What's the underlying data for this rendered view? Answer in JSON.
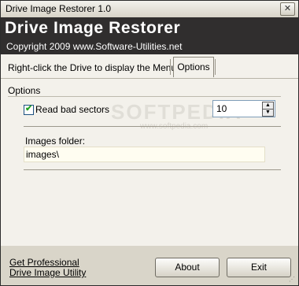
{
  "window": {
    "title": "Drive Image Restorer 1.0",
    "close_glyph": "✕"
  },
  "banner": {
    "title": "Drive Image Restorer",
    "subtitle": "Copyright 2009 www.Software-Utilities.net"
  },
  "tabs": {
    "menu_hint": "Right-click the Drive to display the Menu",
    "options_label": "Options"
  },
  "options": {
    "group_label": "Options",
    "read_bad_sectors_label": "Read bad sectors",
    "read_bad_sectors_checked": true,
    "retry_value": "10",
    "images_folder_label": "Images folder:",
    "images_folder_value": "images\\"
  },
  "watermark": {
    "text": "SOFTPEDIA",
    "url": "www.softpedia.com"
  },
  "footer": {
    "link_line1": "Get Professional",
    "link_line2": "Drive Image Utility",
    "about_label": "About",
    "exit_label": "Exit"
  }
}
